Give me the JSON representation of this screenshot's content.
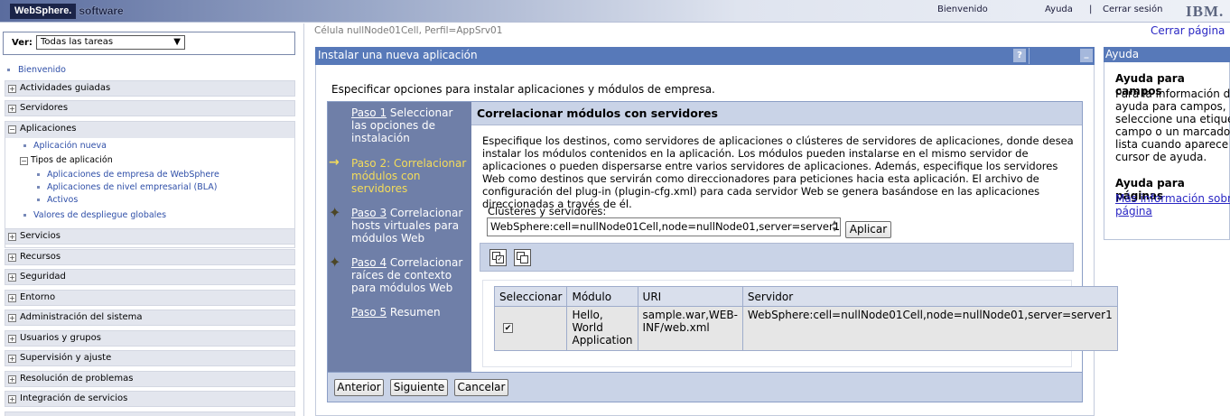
{
  "banner": {
    "brand": "WebSphere.",
    "product": "software",
    "welcome": "Bienvenido",
    "help": "Ayuda",
    "separator": "|",
    "logout": "Cerrar sesión",
    "ibm": "IBM."
  },
  "nav": {
    "view_label": "Ver:",
    "view_value": "Todas las tareas",
    "welcome_link": "Bienvenido",
    "items_top": [
      "Actividades guiadas",
      "Servidores"
    ],
    "applications": {
      "label": "Aplicaciones",
      "new_app": "Aplicación nueva",
      "app_types": "Tipos de aplicación",
      "websphere_apps": "Aplicaciones de empresa de WebSphere",
      "bla_apps": "Aplicaciones de nivel empresarial (BLA)",
      "assets": "Activos",
      "global_deploy": "Valores de despliegue globales"
    },
    "items_bottom": [
      "Servicios",
      "Recursos",
      "Seguridad",
      "Entorno",
      "Administración del sistema",
      "Usuarios y grupos",
      "Supervisión y ajuste",
      "Resolución de problemas",
      "Integración de servicios"
    ]
  },
  "main": {
    "cell_info": "Célula nullNode01Cell, Perfil=AppSrv01",
    "close_page": "Cerrar página",
    "title": "Instalar una nueva aplicación",
    "help_btn": "?",
    "min_btn": "_",
    "intro": "Especificar opciones para instalar aplicaciones y módulos de empresa."
  },
  "wizard": {
    "steps": [
      {
        "num": "Paso 1",
        "label": "Seleccionar las opciones de instalación"
      },
      {
        "num": "Paso 2:",
        "label": "Correlacionar módulos con servidores"
      },
      {
        "num": "Paso 3",
        "label": "Correlacionar hosts virtuales para módulos Web"
      },
      {
        "num": "Paso 4",
        "label": "Correlacionar raíces de contexto para módulos Web"
      },
      {
        "num": "Paso 5",
        "label": "Resumen"
      }
    ],
    "current_arrow": "→",
    "heading": "Correlacionar módulos con servidores",
    "description": "Especifique los destinos, como servidores de aplicaciones o clústeres de servidores de aplicaciones, donde desea instalar los módulos contenidos en la aplicación. Los módulos pueden instalarse en el mismo servidor de aplicaciones o pueden dispersarse entre varios servidores de aplicaciones. Además, especifique los servidores Web como destinos que servirán como direccionadores para peticiones hacia esta aplicación. El archivo de configuración del plug-in (plugin-cfg.xml) para cada servidor Web se genera basándose en las aplicaciones direccionadas a través de él.",
    "clusters_label": "Clústeres y servidores:",
    "clusters_value": "WebSphere:cell=nullNode01Cell,node=nullNode01,server=server1",
    "apply": "Aplicar",
    "table": {
      "headers": [
        "Seleccionar",
        "Módulo",
        "URI",
        "Servidor"
      ],
      "rows": [
        {
          "checked": "✔",
          "module": "Hello, World Application",
          "uri": "sample.war,WEB-INF/web.xml",
          "server": "WebSphere:cell=nullNode01Cell,node=nullNode01,server=server1"
        }
      ]
    },
    "buttons": {
      "back": "Anterior",
      "next": "Siguiente",
      "cancel": "Cancelar"
    }
  },
  "help": {
    "title": "Ayuda",
    "fields_heading": "Ayuda para campos",
    "fields_lines": [
      "Para la información de",
      "ayuda para campos,",
      "seleccione una etiqueta o",
      "campo o un marcador de",
      "lista cuando aparece el",
      "cursor de ayuda."
    ],
    "pages_heading": "Ayuda para páginas",
    "pages_link_lines": [
      "Más información sobre esta",
      "página"
    ]
  }
}
